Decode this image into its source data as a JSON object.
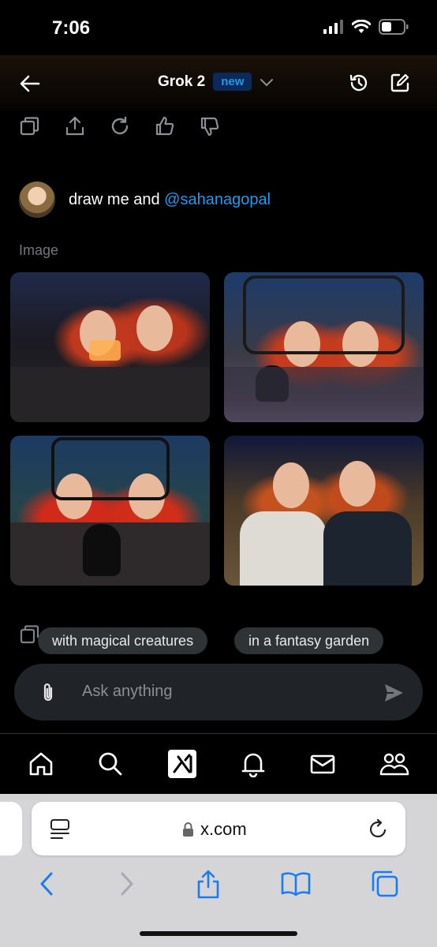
{
  "status_bar": {
    "time": "7:06"
  },
  "header": {
    "title": "Grok 2",
    "badge": "new"
  },
  "conversation": {
    "prompt_text": "draw me and ",
    "prompt_mention": "@sahanagopal",
    "image_label": "Image"
  },
  "suggestions": [
    "with magical creatures",
    "in a fantasy garden"
  ],
  "composer": {
    "placeholder": "Ask anything"
  },
  "bottom_nav": [
    "home",
    "search",
    "grok",
    "notifications",
    "messages",
    "communities"
  ],
  "browser": {
    "url": "x.com"
  },
  "colors": {
    "accent": "#1d9bf0",
    "background": "#000000",
    "chip": "#2f3336",
    "input": "#202327"
  }
}
